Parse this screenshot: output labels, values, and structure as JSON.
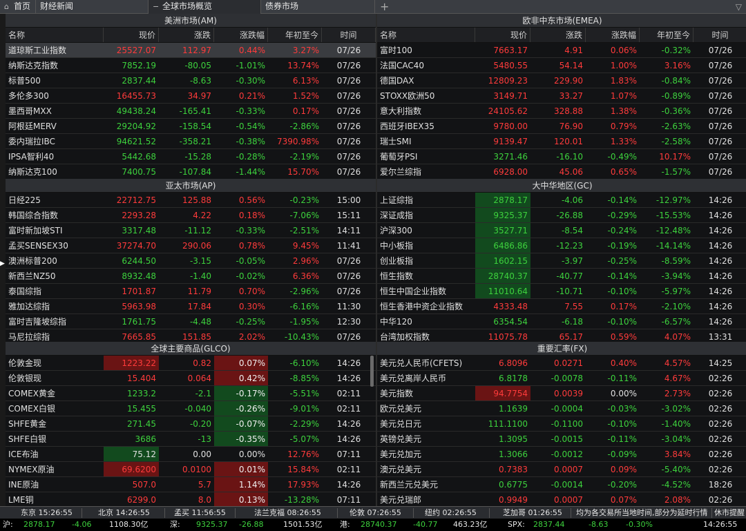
{
  "tabs": [
    {
      "label": "首页"
    },
    {
      "label": "财经新闻"
    },
    {
      "label": "全球市场概览"
    },
    {
      "label": "债券市场"
    }
  ],
  "columns": {
    "name": "名称",
    "price": "现价",
    "change": "涨跌",
    "pct": "涨跌幅",
    "ytd": "年初至今",
    "time": "时间"
  },
  "panels": {
    "am": {
      "title": "美洲市场(AM)",
      "rows": [
        {
          "name": "道琼斯工业指数",
          "price": "25527.07",
          "change": "112.97",
          "pct": "0.44%",
          "ytd": "3.27%",
          "time": "07/26",
          "dir": "up",
          "ydir": "up"
        },
        {
          "name": "纳斯达克指数",
          "price": "7852.19",
          "change": "-80.05",
          "pct": "-1.01%",
          "ytd": "13.74%",
          "time": "07/26",
          "dir": "dn",
          "ydir": "up"
        },
        {
          "name": "标普500",
          "price": "2837.44",
          "change": "-8.63",
          "pct": "-0.30%",
          "ytd": "6.13%",
          "time": "07/26",
          "dir": "dn",
          "ydir": "up"
        },
        {
          "name": "多伦多300",
          "price": "16455.73",
          "change": "34.97",
          "pct": "0.21%",
          "ytd": "1.52%",
          "time": "07/26",
          "dir": "up",
          "ydir": "up"
        },
        {
          "name": "墨西哥MXX",
          "price": "49438.24",
          "change": "-165.41",
          "pct": "-0.33%",
          "ytd": "0.17%",
          "time": "07/26",
          "dir": "dn",
          "ydir": "up"
        },
        {
          "name": "阿根廷MERV",
          "price": "29204.92",
          "change": "-158.54",
          "pct": "-0.54%",
          "ytd": "-2.86%",
          "time": "07/26",
          "dir": "dn",
          "ydir": "dn"
        },
        {
          "name": "委内瑞拉IBC",
          "price": "94621.52",
          "change": "-358.21",
          "pct": "-0.38%",
          "ytd": "7390.98%",
          "time": "07/26",
          "dir": "dn",
          "ydir": "up"
        },
        {
          "name": "IPSA智利40",
          "price": "5442.68",
          "change": "-15.28",
          "pct": "-0.28%",
          "ytd": "-2.19%",
          "time": "07/26",
          "dir": "dn",
          "ydir": "dn"
        },
        {
          "name": "纳斯达克100",
          "price": "7400.75",
          "change": "-107.84",
          "pct": "-1.44%",
          "ytd": "15.70%",
          "time": "07/26",
          "dir": "dn",
          "ydir": "up"
        }
      ]
    },
    "emea": {
      "title": "欧非中东市场(EMEA)",
      "rows": [
        {
          "name": "富时100",
          "price": "7663.17",
          "change": "4.91",
          "pct": "0.06%",
          "ytd": "-0.32%",
          "time": "07/26",
          "dir": "up",
          "ydir": "dn"
        },
        {
          "name": "法国CAC40",
          "price": "5480.55",
          "change": "54.14",
          "pct": "1.00%",
          "ytd": "3.16%",
          "time": "07/26",
          "dir": "up",
          "ydir": "up"
        },
        {
          "name": "德国DAX",
          "price": "12809.23",
          "change": "229.90",
          "pct": "1.83%",
          "ytd": "-0.84%",
          "time": "07/26",
          "dir": "up",
          "ydir": "dn"
        },
        {
          "name": "STOXX欧洲50",
          "price": "3149.71",
          "change": "33.27",
          "pct": "1.07%",
          "ytd": "-0.89%",
          "time": "07/26",
          "dir": "up",
          "ydir": "dn"
        },
        {
          "name": "意大利指数",
          "price": "24105.62",
          "change": "328.88",
          "pct": "1.38%",
          "ytd": "-0.36%",
          "time": "07/26",
          "dir": "up",
          "ydir": "dn"
        },
        {
          "name": "西班牙IBEX35",
          "price": "9780.00",
          "change": "76.90",
          "pct": "0.79%",
          "ytd": "-2.63%",
          "time": "07/26",
          "dir": "up",
          "ydir": "dn"
        },
        {
          "name": "瑞士SMI",
          "price": "9139.47",
          "change": "120.01",
          "pct": "1.33%",
          "ytd": "-2.58%",
          "time": "07/26",
          "dir": "up",
          "ydir": "dn"
        },
        {
          "name": "葡萄牙PSI",
          "price": "3271.46",
          "change": "-16.10",
          "pct": "-0.49%",
          "ytd": "10.17%",
          "time": "07/26",
          "dir": "dn",
          "ydir": "up"
        },
        {
          "name": "爱尔兰综指",
          "price": "6928.00",
          "change": "45.06",
          "pct": "0.65%",
          "ytd": "-1.57%",
          "time": "07/26",
          "dir": "up",
          "ydir": "dn"
        }
      ]
    },
    "ap": {
      "title": "亚太市场(AP)",
      "rows": [
        {
          "name": "日经225",
          "price": "22712.75",
          "change": "125.88",
          "pct": "0.56%",
          "ytd": "-0.23%",
          "time": "15:00",
          "dir": "up",
          "ydir": "dn"
        },
        {
          "name": "韩国综合指数",
          "price": "2293.28",
          "change": "4.22",
          "pct": "0.18%",
          "ytd": "-7.06%",
          "time": "15:11",
          "dir": "up",
          "ydir": "dn"
        },
        {
          "name": "富时新加坡STI",
          "price": "3317.48",
          "change": "-11.12",
          "pct": "-0.33%",
          "ytd": "-2.51%",
          "time": "14:11",
          "dir": "dn",
          "ydir": "dn"
        },
        {
          "name": "孟买SENSEX30",
          "price": "37274.70",
          "change": "290.06",
          "pct": "0.78%",
          "ytd": "9.45%",
          "time": "11:41",
          "dir": "up",
          "ydir": "up"
        },
        {
          "name": "澳洲标普200",
          "price": "6244.50",
          "change": "-3.15",
          "pct": "-0.05%",
          "ytd": "2.96%",
          "time": "07/26",
          "dir": "dn",
          "ydir": "up"
        },
        {
          "name": "新西兰NZ50",
          "price": "8932.48",
          "change": "-1.40",
          "pct": "-0.02%",
          "ytd": "6.36%",
          "time": "07/26",
          "dir": "dn",
          "ydir": "up"
        },
        {
          "name": "泰国综指",
          "price": "1701.87",
          "change": "11.79",
          "pct": "0.70%",
          "ytd": "-2.96%",
          "time": "07/26",
          "dir": "up",
          "ydir": "dn"
        },
        {
          "name": "雅加达综指",
          "price": "5963.98",
          "change": "17.84",
          "pct": "0.30%",
          "ytd": "-6.16%",
          "time": "11:30",
          "dir": "up",
          "ydir": "dn"
        },
        {
          "name": "富时吉隆坡综指",
          "price": "1761.75",
          "change": "-4.48",
          "pct": "-0.25%",
          "ytd": "-1.95%",
          "time": "12:30",
          "dir": "dn",
          "ydir": "dn"
        },
        {
          "name": "马尼拉综指",
          "price": "7665.85",
          "change": "151.85",
          "pct": "2.02%",
          "ytd": "-10.43%",
          "time": "07/26",
          "dir": "up",
          "ydir": "dn"
        }
      ]
    },
    "gc": {
      "title": "大中华地区(GC)",
      "rows": [
        {
          "name": "上证综指",
          "price": "2878.17",
          "change": "-4.06",
          "pct": "-0.14%",
          "ytd": "-12.97%",
          "time": "14:26",
          "dir": "dn",
          "ydir": "dn",
          "phl": "g"
        },
        {
          "name": "深证成指",
          "price": "9325.37",
          "change": "-26.88",
          "pct": "-0.29%",
          "ytd": "-15.53%",
          "time": "14:26",
          "dir": "dn",
          "ydir": "dn",
          "phl": "g"
        },
        {
          "name": "沪深300",
          "price": "3527.71",
          "change": "-8.54",
          "pct": "-0.24%",
          "ytd": "-12.48%",
          "time": "14:26",
          "dir": "dn",
          "ydir": "dn",
          "phl": "g"
        },
        {
          "name": "中小板指",
          "price": "6486.86",
          "change": "-12.23",
          "pct": "-0.19%",
          "ytd": "-14.14%",
          "time": "14:26",
          "dir": "dn",
          "ydir": "dn",
          "phl": "g"
        },
        {
          "name": "创业板指",
          "price": "1602.15",
          "change": "-3.97",
          "pct": "-0.25%",
          "ytd": "-8.59%",
          "time": "14:26",
          "dir": "dn",
          "ydir": "dn",
          "phl": "g"
        },
        {
          "name": "恒生指数",
          "price": "28740.37",
          "change": "-40.77",
          "pct": "-0.14%",
          "ytd": "-3.94%",
          "time": "14:26",
          "dir": "dn",
          "ydir": "dn",
          "phl": "g"
        },
        {
          "name": "恒生中国企业指数",
          "price": "11010.64",
          "change": "-10.71",
          "pct": "-0.10%",
          "ytd": "-5.97%",
          "time": "14:26",
          "dir": "dn",
          "ydir": "dn",
          "phl": "g"
        },
        {
          "name": "恒生香港中资企业指数",
          "price": "4333.48",
          "change": "7.55",
          "pct": "0.17%",
          "ytd": "-2.10%",
          "time": "14:26",
          "dir": "up",
          "ydir": "dn"
        },
        {
          "name": "中华120",
          "price": "6354.54",
          "change": "-6.18",
          "pct": "-0.10%",
          "ytd": "-6.57%",
          "time": "14:26",
          "dir": "dn",
          "ydir": "dn"
        },
        {
          "name": "台湾加权指数",
          "price": "11075.78",
          "change": "65.17",
          "pct": "0.59%",
          "ytd": "4.07%",
          "time": "13:31",
          "dir": "up",
          "ydir": "up"
        }
      ]
    },
    "glco": {
      "title": "全球主要商品(GLCO)",
      "rows": [
        {
          "name": "伦敦金现",
          "price": "1223.22",
          "change": "0.82",
          "pct": "0.07%",
          "ytd": "-6.10%",
          "time": "14:26",
          "dir": "up",
          "ydir": "dn",
          "phl": "r",
          "pchl": "r"
        },
        {
          "name": "伦敦银现",
          "price": "15.404",
          "change": "0.064",
          "pct": "0.42%",
          "ytd": "-8.85%",
          "time": "14:26",
          "dir": "up",
          "ydir": "dn",
          "pchl": "r"
        },
        {
          "name": "COMEX黄金",
          "price": "1233.2",
          "change": "-2.1",
          "pct": "-0.17%",
          "ytd": "-5.51%",
          "time": "02:11",
          "dir": "dn",
          "ydir": "dn",
          "pchl": "g"
        },
        {
          "name": "COMEX白银",
          "price": "15.455",
          "change": "-0.040",
          "pct": "-0.26%",
          "ytd": "-9.01%",
          "time": "02:11",
          "dir": "dn",
          "ydir": "dn",
          "pchl": "g"
        },
        {
          "name": "SHFE黄金",
          "price": "271.45",
          "change": "-0.20",
          "pct": "-0.07%",
          "ytd": "-2.29%",
          "time": "14:26",
          "dir": "dn",
          "ydir": "dn",
          "pchl": "g"
        },
        {
          "name": "SHFE白银",
          "price": "3686",
          "change": "-13",
          "pct": "-0.35%",
          "ytd": "-5.07%",
          "time": "14:26",
          "dir": "dn",
          "ydir": "dn",
          "pchl": "g"
        },
        {
          "name": "ICE布油",
          "price": "75.12",
          "change": "0.00",
          "pct": "0.00%",
          "ytd": "12.76%",
          "time": "07:11",
          "dir": "fl",
          "ydir": "up",
          "phl": "g"
        },
        {
          "name": "NYMEX原油",
          "price": "69.6200",
          "change": "0.0100",
          "pct": "0.01%",
          "ytd": "15.84%",
          "time": "02:11",
          "dir": "up",
          "ydir": "up",
          "phl": "r",
          "pchl": "r"
        },
        {
          "name": "INE原油",
          "price": "507.0",
          "change": "5.7",
          "pct": "1.14%",
          "ytd": "17.93%",
          "time": "14:26",
          "dir": "up",
          "ydir": "up",
          "pchl": "r"
        },
        {
          "name": "LME铜",
          "price": "6299.0",
          "change": "8.0",
          "pct": "0.13%",
          "ytd": "-13.28%",
          "time": "07:11",
          "dir": "up",
          "ydir": "dn",
          "pchl": "r"
        }
      ]
    },
    "fx": {
      "title": "重要汇率(FX)",
      "rows": [
        {
          "name": "美元兑人民币(CFETS)",
          "price": "6.8096",
          "change": "0.0271",
          "pct": "0.40%",
          "ytd": "4.57%",
          "time": "14:25",
          "dir": "up",
          "ydir": "up"
        },
        {
          "name": "美元兑离岸人民币",
          "price": "6.8178",
          "change": "-0.0078",
          "pct": "-0.11%",
          "ytd": "4.67%",
          "time": "02:26",
          "dir": "dn",
          "ydir": "up"
        },
        {
          "name": "美元指数",
          "price": "94.7754",
          "change": "0.0039",
          "pct": "0.00%",
          "ytd": "2.73%",
          "time": "02:26",
          "dir": "up",
          "ydir": "up",
          "phl": "r",
          "pcdir": "fl"
        },
        {
          "name": "欧元兑美元",
          "price": "1.1639",
          "change": "-0.0004",
          "pct": "-0.03%",
          "ytd": "-3.02%",
          "time": "02:26",
          "dir": "dn",
          "ydir": "dn"
        },
        {
          "name": "美元兑日元",
          "price": "111.1100",
          "change": "-0.1100",
          "pct": "-0.10%",
          "ytd": "-1.40%",
          "time": "02:26",
          "dir": "dn",
          "ydir": "dn"
        },
        {
          "name": "英镑兑美元",
          "price": "1.3095",
          "change": "-0.0015",
          "pct": "-0.11%",
          "ytd": "-3.04%",
          "time": "02:26",
          "dir": "dn",
          "ydir": "dn"
        },
        {
          "name": "美元兑加元",
          "price": "1.3066",
          "change": "-0.0012",
          "pct": "-0.09%",
          "ytd": "3.84%",
          "time": "02:26",
          "dir": "dn",
          "ydir": "up"
        },
        {
          "name": "澳元兑美元",
          "price": "0.7383",
          "change": "0.0007",
          "pct": "0.09%",
          "ytd": "-5.40%",
          "time": "02:26",
          "dir": "up",
          "ydir": "dn"
        },
        {
          "name": "新西兰元兑美元",
          "price": "0.6775",
          "change": "-0.0014",
          "pct": "-0.20%",
          "ytd": "-4.52%",
          "time": "18:26",
          "dir": "dn",
          "ydir": "dn"
        },
        {
          "name": "美元兑瑞郎",
          "price": "0.9949",
          "change": "0.0007",
          "pct": "0.07%",
          "ytd": "2.08%",
          "time": "02:26",
          "dir": "up",
          "ydir": "up"
        }
      ]
    }
  },
  "clocks": [
    {
      "label": "东京 15:26:55"
    },
    {
      "label": "北京 14:26:55"
    },
    {
      "label": "孟买 11:56:55"
    },
    {
      "label": "法兰克福 08:26:55"
    },
    {
      "label": "伦敦 07:26:55"
    },
    {
      "label": "纽约 02:26:55"
    },
    {
      "label": "芝加哥 01:26:55"
    }
  ],
  "notice": "均为各交易所当地时间,部分为延时行情",
  "status": "休市提醒",
  "status_time": "14:26:55",
  "ticker": [
    {
      "label": "沪:",
      "price": "2878.17",
      "change": "-4.06",
      "amount": "1108.30亿"
    },
    {
      "label": "深:",
      "price": "9325.37",
      "change": "-26.88",
      "amount": "1501.53亿"
    },
    {
      "label": "港:",
      "price": "28740.37",
      "change": "-40.77",
      "amount": "463.23亿"
    },
    {
      "label": "SPX:",
      "price": "2837.44",
      "change": "-8.63",
      "amount": "-0.30%"
    }
  ],
  "colors": {
    "up": "#ff3b3b",
    "down": "#3dd23d",
    "bg": "#121315"
  }
}
